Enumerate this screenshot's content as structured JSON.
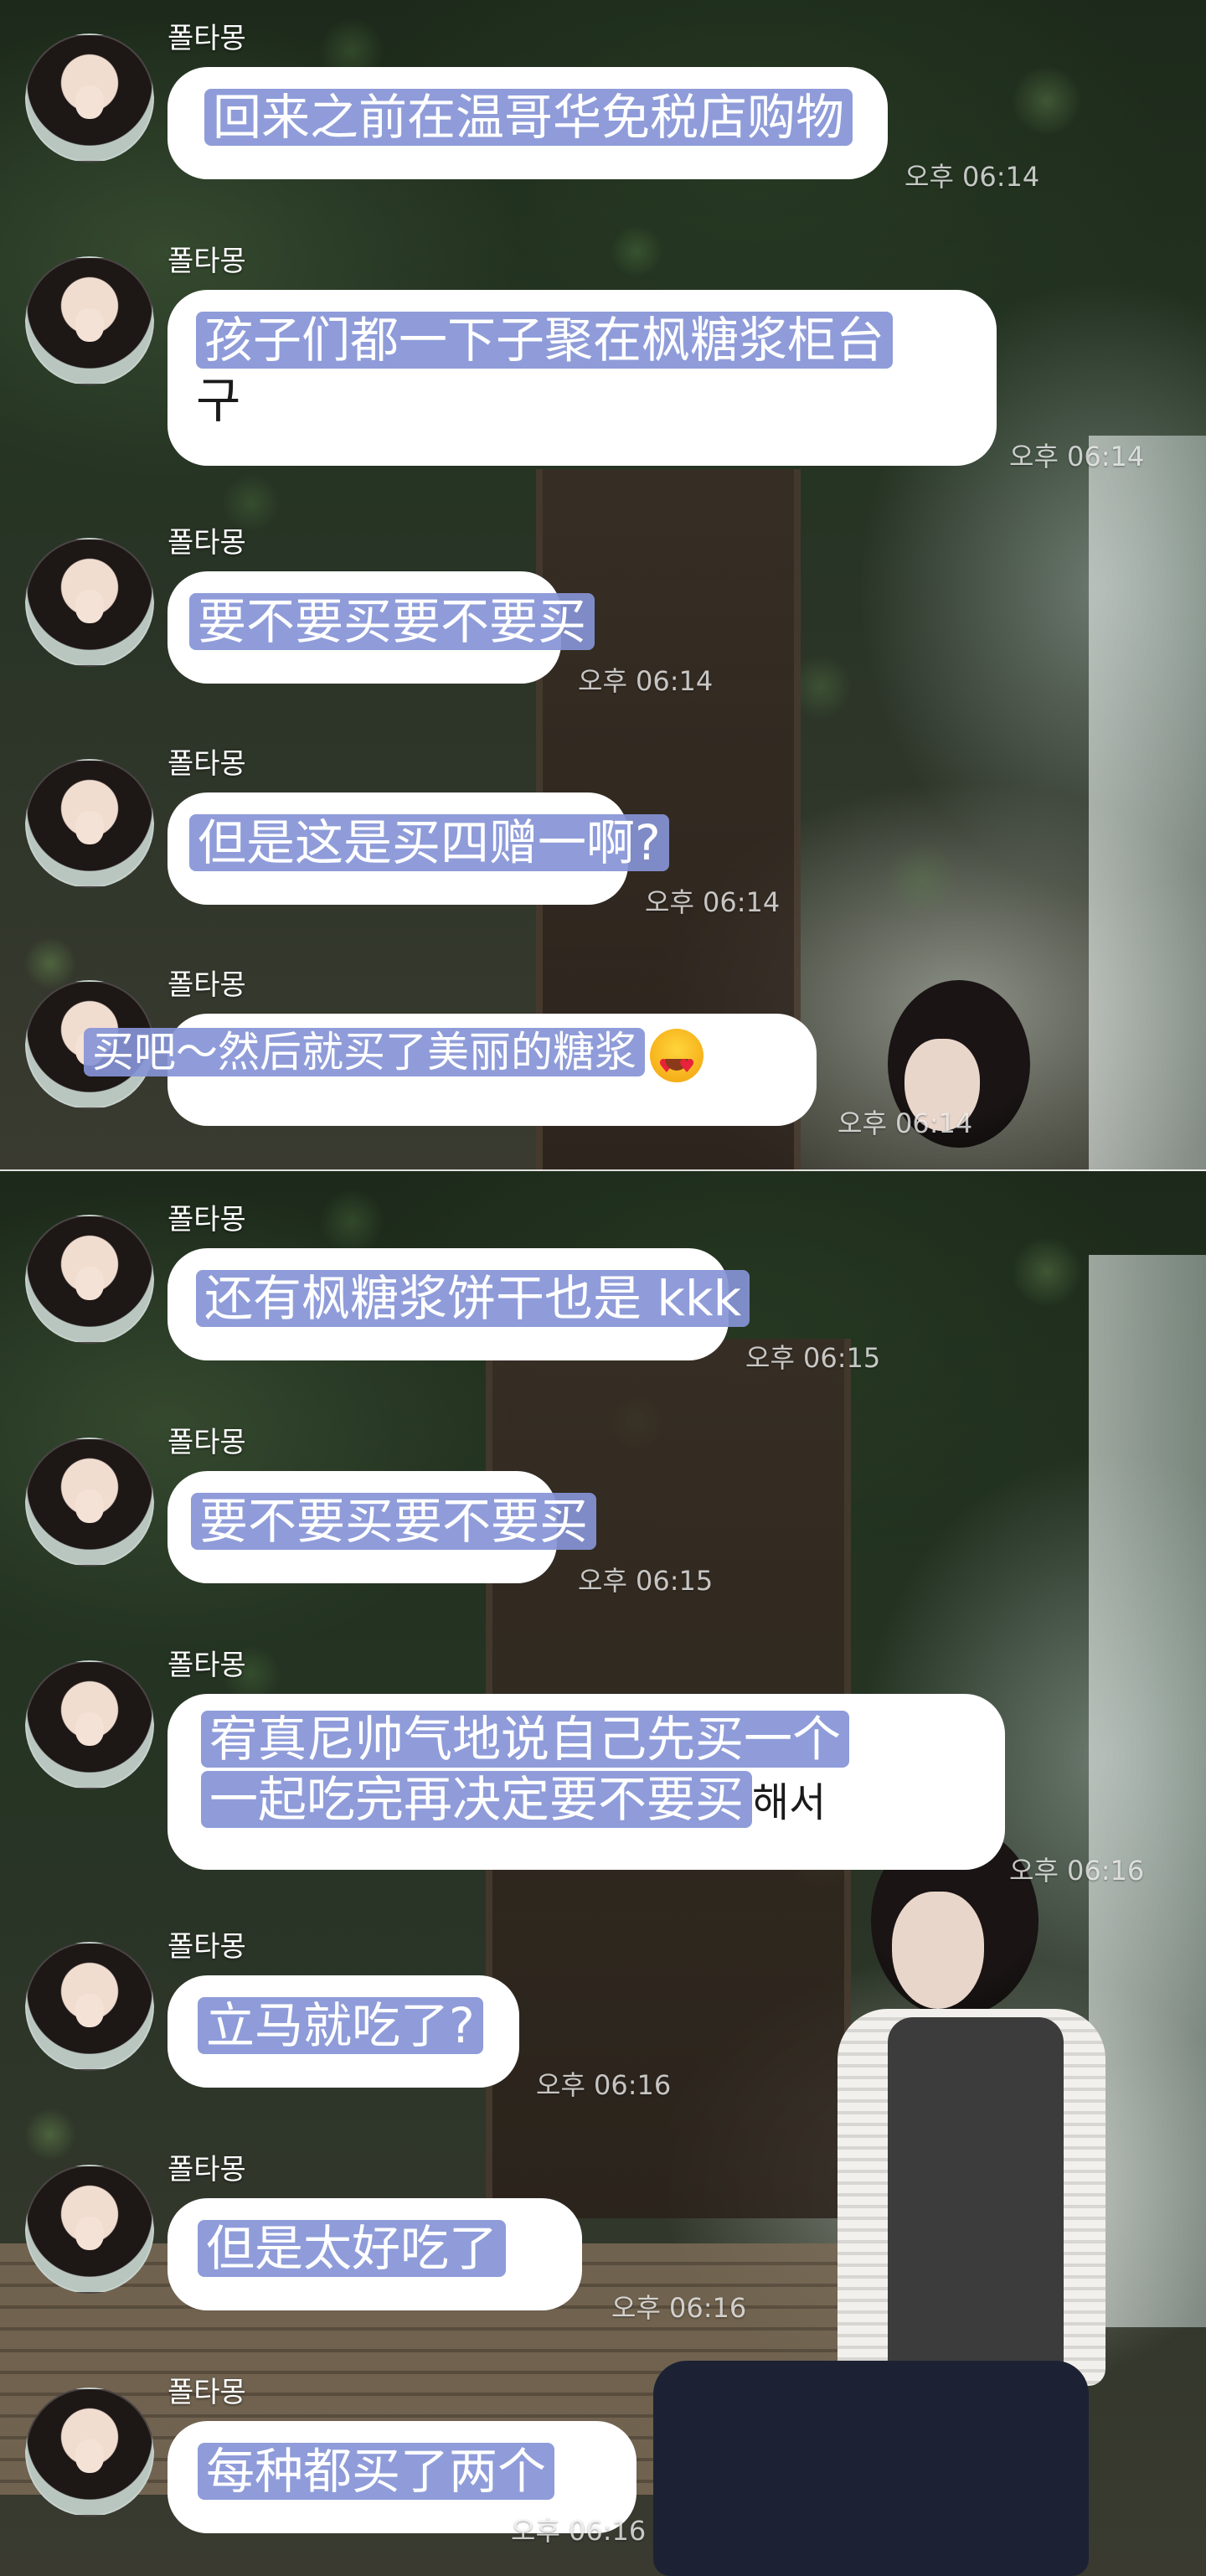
{
  "sender": "폴타몽",
  "screenshots": [
    {
      "messages": [
        {
          "text": "回来之前在温哥华免税店购物",
          "time": "오후 06:14"
        },
        {
          "lines": [
            "孩子们都一下子聚在枫糖浆柜台",
            "구"
          ],
          "time": "오후 06:14"
        },
        {
          "text": "要不要买要不要买",
          "time": "오후 06:14"
        },
        {
          "text": "但是这是买四赠一啊?",
          "time": "오후 06:14"
        },
        {
          "text": "买吧～然后就买了美丽的糖浆",
          "emoji": "heart-eyes-emoji",
          "time": "오후 06:14"
        }
      ]
    },
    {
      "messages": [
        {
          "text": "还有枫糖浆饼干也是 kkk",
          "time": "오후 06:15"
        },
        {
          "text": "要不要买要不要买",
          "time": "오후 06:15"
        },
        {
          "lines": [
            "宥真尼帅气地说自己先买一个",
            "一起吃完再决定要不要买"
          ],
          "trailing": "해서",
          "time": "오후 06:16"
        },
        {
          "text": "立马就吃了?",
          "time": "오후 06:16"
        },
        {
          "text": "但是太好吃了",
          "time": "오후 06:16"
        },
        {
          "text": "每种都买了两个",
          "time": "오후 06:16"
        }
      ]
    }
  ],
  "colors": {
    "bubble": "#ffffff",
    "highlight": "#8694d6",
    "text": "#1a1a1a",
    "name": "#ffffff"
  }
}
